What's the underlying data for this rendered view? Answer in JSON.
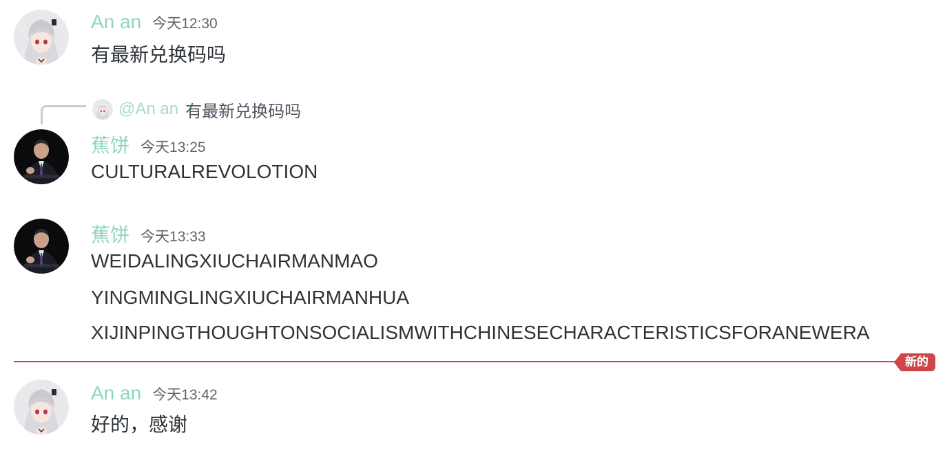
{
  "messages": [
    {
      "username": "An an",
      "timestamp": "今天12:30",
      "lines": [
        "有最新兑换码吗"
      ]
    },
    {
      "reply_to": {
        "mention": "@An an",
        "text": "有最新兑换码吗"
      },
      "username": "蕉饼",
      "timestamp": "今天13:25",
      "lines": [
        "CULTURALREVOLOTION"
      ]
    },
    {
      "username": "蕉饼",
      "timestamp": "今天13:33",
      "lines": [
        "WEIDALINGXIUCHAIRMANMAO",
        "YINGMINGLINGXIUCHAIRMANHUA",
        "XIJINPINGTHOUGHTONSOCIALISMWITHCHINESECHARACTERISTICSFORANEWERA"
      ]
    },
    {
      "username": "An an",
      "timestamp": "今天13:42",
      "lines": [
        "好的，感谢"
      ]
    }
  ],
  "new_divider": {
    "label": "新的"
  },
  "colors": {
    "username": "#8fd6bd",
    "divider": "#d0454a",
    "text": "#2e3338",
    "timestamp": "#5f6369"
  },
  "icons": {
    "anime_avatar": "anime-girl-avatar",
    "man_avatar": "man-in-suit-avatar"
  }
}
